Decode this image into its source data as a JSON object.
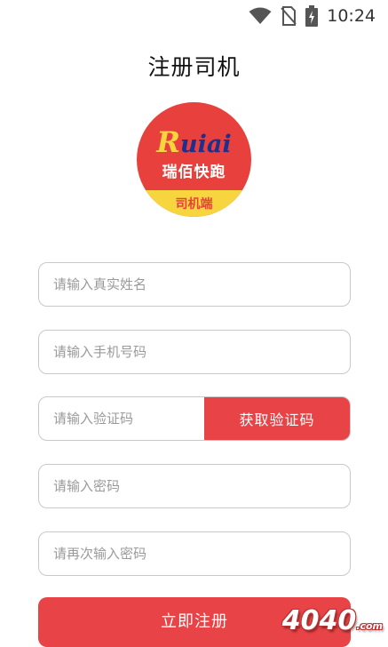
{
  "status_bar": {
    "time": "10:24",
    "icons": [
      "wifi-icon",
      "no-sim-icon",
      "battery-charging-icon"
    ]
  },
  "header": {
    "title": "注册司机"
  },
  "logo": {
    "brand_first": "R",
    "brand_rest": "uiai",
    "name": "瑞佰快跑",
    "subtitle": "司机端",
    "colors": {
      "background": "#e8403c",
      "band": "#f6d53f",
      "brand": "#1d2f8f"
    }
  },
  "form": {
    "name_placeholder": "请输入真实姓名",
    "phone_placeholder": "请输入手机号码",
    "code_placeholder": "请输入验证码",
    "get_code_label": "获取验证码",
    "password_placeholder": "请输入密码",
    "confirm_password_placeholder": "请再次输入密码",
    "submit_label": "立即注册"
  },
  "watermark": {
    "text": "4040",
    "suffix": ".com"
  },
  "colors": {
    "accent": "#e84346",
    "border": "#c9c9c9",
    "placeholder": "#9a9a9a"
  }
}
